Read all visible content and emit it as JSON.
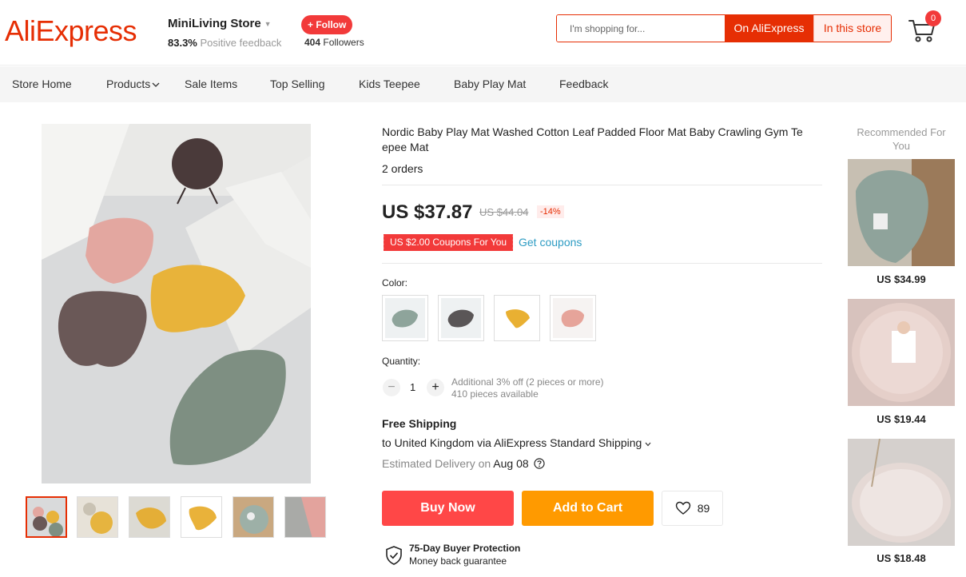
{
  "header": {
    "logo": "AliExpress",
    "store_name": "MiniLiving Store",
    "feedback_pct": "83.3%",
    "feedback_label": "Positive feedback",
    "follow_label": "+ Follow",
    "followers_count": "404",
    "followers_label": "Followers",
    "search_placeholder": "I'm shopping for...",
    "search_on_aliexpress": "On AliExpress",
    "search_in_store": "In this store",
    "cart_count": "0"
  },
  "nav": {
    "items": [
      "Store Home",
      "Products",
      "Sale Items",
      "Top Selling",
      "Kids Teepee",
      "Baby Play Mat",
      "Feedback"
    ]
  },
  "product": {
    "title": "Nordic Baby Play Mat Washed Cotton Leaf Padded Floor Mat Baby Crawling Gym Te epee Mat",
    "orders": "2 orders",
    "price": "US $37.87",
    "original_price": "US $44.04",
    "discount": "-14%",
    "coupon": "US $2.00 Coupons For You",
    "get_coupons": "Get coupons",
    "color_label": "Color:",
    "colors": [
      "sage-green",
      "charcoal-grey",
      "mustard-yellow",
      "blush-pink"
    ],
    "swatch_colors": [
      "#8ea49b",
      "#5a5657",
      "#e9b032",
      "#e6a49a"
    ],
    "quantity_label": "Quantity:",
    "quantity_minus": "−",
    "quantity_plus": "+",
    "quantity": "1",
    "quantity_note_1": "Additional 3% off (2 pieces or more)",
    "quantity_note_2": "410 pieces available",
    "shipping_title": "Free Shipping",
    "shipping_dest": "to United Kingdom via AliExpress Standard Shipping",
    "delivery_label": "Estimated Delivery on",
    "delivery_date": "Aug 08",
    "buy_now": "Buy Now",
    "add_to_cart": "Add to Cart",
    "wishlist_count": "89",
    "protection_title": "75-Day Buyer Protection",
    "protection_sub": "Money back guarantee"
  },
  "recommended": {
    "title": "Recommended For You",
    "items": [
      {
        "price": "US $34.99"
      },
      {
        "price": "US $19.44"
      },
      {
        "price": "US $18.48"
      }
    ]
  },
  "colors": {
    "brand_red": "#e62e04",
    "buy_red": "#ff4747",
    "cart_orange": "#ff9a00",
    "link_blue": "#2e9cc3"
  }
}
